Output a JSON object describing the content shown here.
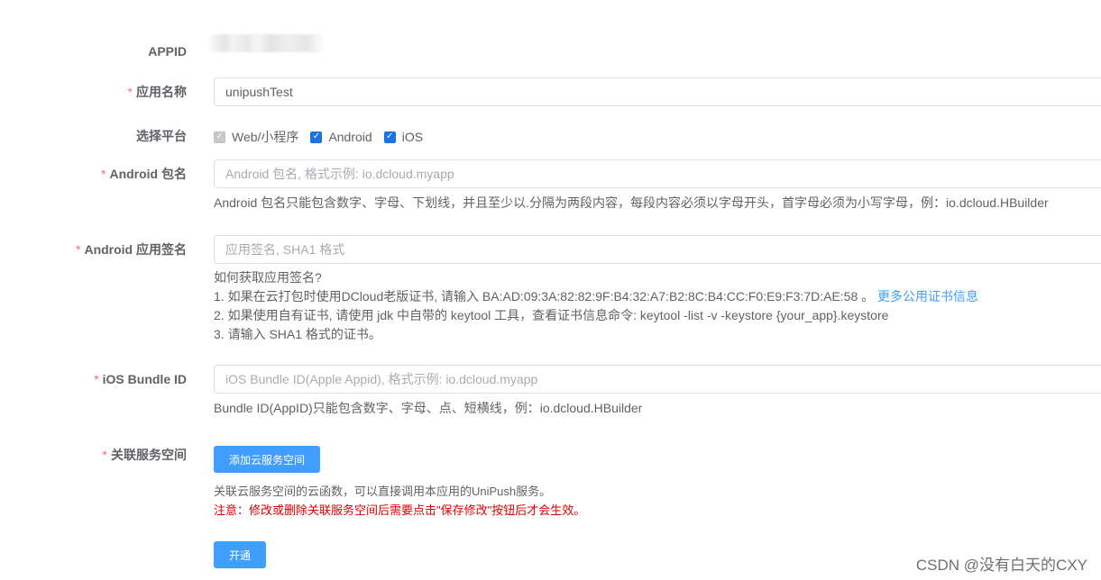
{
  "appid": {
    "label": "APPID"
  },
  "app_name": {
    "label": "应用名称",
    "value": "unipushTest"
  },
  "platforms": {
    "label": "选择平台",
    "options": [
      {
        "label": "Web/小程序",
        "checked": true,
        "disabled": true
      },
      {
        "label": "Android",
        "checked": true,
        "disabled": false
      },
      {
        "label": "iOS",
        "checked": true,
        "disabled": false
      }
    ]
  },
  "android_package": {
    "label": "Android 包名",
    "placeholder": "Android 包名, 格式示例: io.dcloud.myapp",
    "help": "Android 包名只能包含数字、字母、下划线，并且至少以.分隔为两段内容，每段内容必须以字母开头，首字母必须为小写字母，例：io.dcloud.HBuilder"
  },
  "android_signature": {
    "label": "Android 应用签名",
    "placeholder": "应用签名, SHA1 格式",
    "help_title": "如何获取应用签名?",
    "help_line1": "1. 如果在云打包时使用DCloud老版证书, 请输入 BA:AD:09:3A:82:82:9F:B4:32:A7:B2:8C:B4:CC:F0:E9:F3:7D:AE:58 。",
    "help_link": "更多公用证书信息",
    "help_line2": "2. 如果使用自有证书, 请使用 jdk 中自带的 keytool 工具，查看证书信息命令: keytool -list -v -keystore {your_app}.keystore",
    "help_line3": "3. 请输入 SHA1 格式的证书。"
  },
  "ios_bundle": {
    "label": "iOS Bundle ID",
    "placeholder": "iOS Bundle ID(Apple Appid), 格式示例: io.dcloud.myapp",
    "help": "Bundle ID(AppID)只能包含数字、字母、点、短横线，例：io.dcloud.HBuilder"
  },
  "service_space": {
    "label": "关联服务空间",
    "button": "添加云服务空间",
    "help": "关联云服务空间的云函数，可以直接调用本应用的UniPush服务。",
    "warning": "注意：修改或删除关联服务空间后需要点击\"保存修改\"按钮后才会生效。"
  },
  "required_mark": "*",
  "submit_button": "开通",
  "watermark": "CSDN @没有白天的CXY",
  "colors": {
    "primary": "#409eff",
    "required": "#f56c6c",
    "warning": "#e00000"
  }
}
